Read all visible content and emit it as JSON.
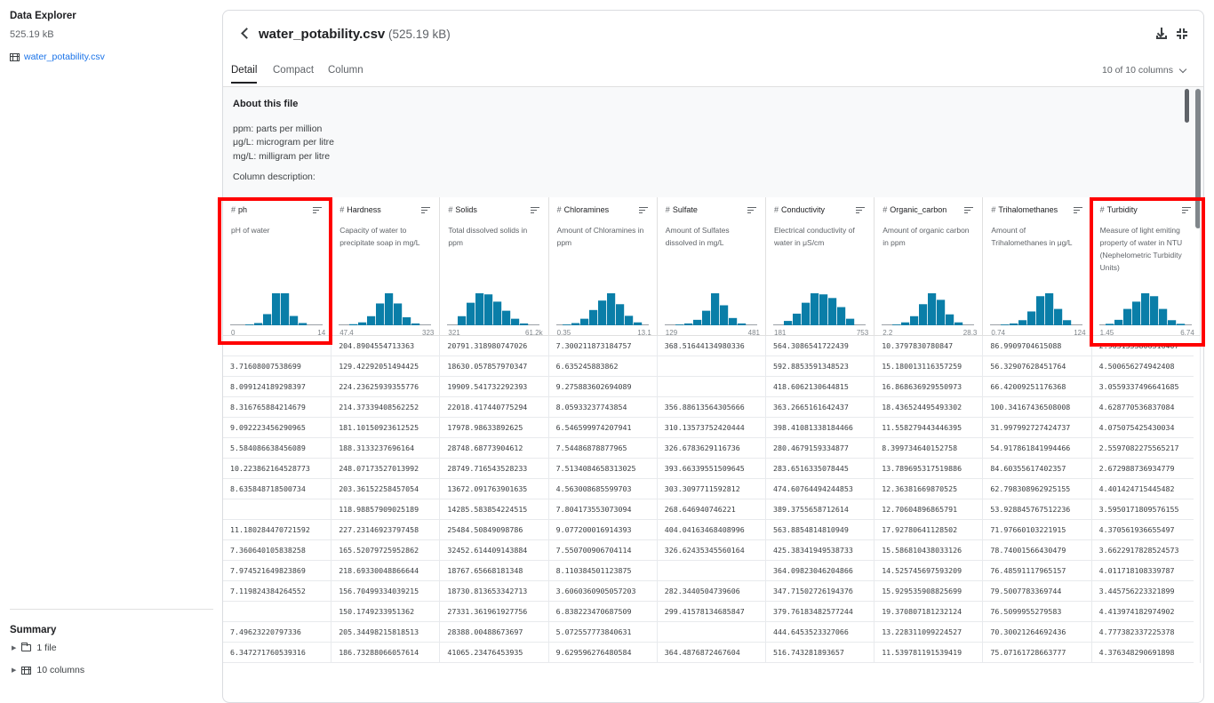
{
  "sidebar": {
    "title": "Data Explorer",
    "size": "525.19 kB",
    "file_name": "water_potability.csv",
    "summary_title": "Summary",
    "summary_items": [
      "1 file",
      "10 columns"
    ]
  },
  "header": {
    "file_name": "water_potability.csv",
    "file_size": "(525.19 kB)",
    "icons": [
      "back-icon",
      "download-icon",
      "collapse-icon"
    ]
  },
  "tabs": [
    "Detail",
    "Compact",
    "Column"
  ],
  "active_tab": "Detail",
  "column_count": "10 of 10 columns",
  "about": {
    "title": "About this file",
    "lines": [
      "ppm: parts per million",
      "μg/L: microgram per litre",
      "mg/L: milligram per litre",
      "Column description:"
    ]
  },
  "columns": [
    {
      "name": "ph",
      "desc": "pH of water",
      "min": "0",
      "max": "14",
      "hist": [
        2,
        6,
        30,
        86,
        86,
        25,
        6
      ]
    },
    {
      "name": "Hardness",
      "desc": "Capacity of water to precipitate soap in mg/L",
      "min": "47.4",
      "max": "323",
      "hist": [
        3,
        8,
        25,
        60,
        88,
        60,
        22,
        5
      ]
    },
    {
      "name": "Solids",
      "desc": "Total dissolved solids in ppm",
      "min": "321",
      "max": "61.2k",
      "hist": [
        25,
        62,
        88,
        85,
        65,
        40,
        18,
        5
      ]
    },
    {
      "name": "Chloramines",
      "desc": "Amount of Chloramines in ppm",
      "min": "0.35",
      "max": "13.1",
      "hist": [
        2,
        6,
        18,
        42,
        68,
        88,
        58,
        26,
        8
      ]
    },
    {
      "name": "Sulfate",
      "desc": "Amount of Sulfates dissolved in mg/L",
      "min": "129",
      "max": "481",
      "hist": [
        2,
        5,
        15,
        40,
        88,
        55,
        20,
        5
      ]
    },
    {
      "name": "Conductivity",
      "desc": "Electrical conductivity of water in μS/cm",
      "min": "181",
      "max": "753",
      "hist": [
        12,
        32,
        62,
        88,
        85,
        75,
        50,
        18
      ]
    },
    {
      "name": "Organic_carbon",
      "desc": "Amount of organic carbon in ppm",
      "min": "2.2",
      "max": "28.3",
      "hist": [
        2,
        8,
        25,
        58,
        88,
        70,
        30,
        8
      ]
    },
    {
      "name": "Trihalomethanes",
      "desc": "Amount of Trihalomethanes in μg/L",
      "min": "0.74",
      "max": "124",
      "hist": [
        2,
        5,
        14,
        38,
        80,
        88,
        45,
        14
      ]
    },
    {
      "name": "Turbidity",
      "desc": "Measure of light emiting property of water in NTU (Nephelometric Turbidity Units)",
      "min": "1.45",
      "max": "6.74",
      "hist": [
        4,
        15,
        45,
        65,
        88,
        80,
        45,
        14,
        4
      ]
    }
  ],
  "rows": [
    [
      "",
      "204.8904554713363",
      "20791.318980747026",
      "7.300211873184757",
      "368.51644134980336",
      "564.3086541722439",
      "10.3797830780847",
      "86.9909704615088",
      "2.9631353806316407"
    ],
    [
      "3.71608007538699",
      "129.42292051494425",
      "18630.057857970347",
      "6.635245883862",
      "",
      "592.8853591348523",
      "15.180013116357259",
      "56.32907628451764",
      "4.500656274942408"
    ],
    [
      "8.099124189298397",
      "224.23625939355776",
      "19909.541732292393",
      "9.275883602694089",
      "",
      "418.6062130644815",
      "16.868636929550973",
      "66.42009251176368",
      "3.0559337496641685"
    ],
    [
      "8.316765884214679",
      "214.37339408562252",
      "22018.417440775294",
      "8.05933237743854",
      "356.88613564305666",
      "363.2665161642437",
      "18.436524495493302",
      "100.34167436508008",
      "4.628770536837084"
    ],
    [
      "9.092223456290965",
      "181.10150923612525",
      "17978.98633892625",
      "6.546599974207941",
      "310.13573752420444",
      "398.41081338184466",
      "11.558279443446395",
      "31.997992727424737",
      "4.075075425430034"
    ],
    [
      "5.584086638456089",
      "188.3133237696164",
      "28748.68773904612",
      "7.54486878877965",
      "326.6783629116736",
      "280.4679159334877",
      "8.399734640152758",
      "54.917861841994466",
      "2.5597082275565217"
    ],
    [
      "10.223862164528773",
      "248.07173527013992",
      "28749.716543528233",
      "7.5134084658313025",
      "393.66339551509645",
      "283.6516335078445",
      "13.789695317519886",
      "84.60355617402357",
      "2.672988736934779"
    ],
    [
      "8.635848718500734",
      "203.36152258457054",
      "13672.091763901635",
      "4.563008685599703",
      "303.3097711592812",
      "474.60764494244853",
      "12.36381669870525",
      "62.798308962925155",
      "4.401424715445482"
    ],
    [
      "",
      "118.98857909025189",
      "14285.583854224515",
      "7.804173553073094",
      "268.646940746221",
      "389.3755658712614",
      "12.70604896865791",
      "53.928845767512236",
      "3.5950171809576155"
    ],
    [
      "11.180284470721592",
      "227.23146923797458",
      "25484.50849098786",
      "9.077200016914393",
      "404.04163468408996",
      "563.8854814810949",
      "17.92780641128502",
      "71.97660103221915",
      "4.370561936655497"
    ],
    [
      "7.360640105838258",
      "165.52079725952862",
      "32452.614409143884",
      "7.550700906704114",
      "326.62435345560164",
      "425.38341949538733",
      "15.586810438033126",
      "78.74001566430479",
      "3.6622917828524573"
    ],
    [
      "7.974521649823869",
      "218.69330048866644",
      "18767.65668181348",
      "8.110384501123875",
      "",
      "364.09823046204866",
      "14.525745697593209",
      "76.48591117965157",
      "4.011718108339787"
    ],
    [
      "7.119824384264552",
      "156.70499334039215",
      "18730.813653342713",
      "3.6060360905057203",
      "282.3440504739606",
      "347.7150272619437б",
      "15.929535908825699",
      "79.5007783369744",
      "3.445756223321899"
    ],
    [
      "",
      "150.1749233951362",
      "27331.361961927756",
      "6.838223470687509",
      "299.41578134685847",
      "379.76183482577244",
      "19.370807181232124",
      "76.5099955279583",
      "4.413974182974902"
    ],
    [
      "7.49623220797336",
      "205.34498215818513",
      "28388.00488673697",
      "5.072557773840631",
      "",
      "444.6453523327066",
      "13.228311099224527",
      "70.30021264692436",
      "4.777382337225378"
    ],
    [
      "6.347271760539316",
      "186.73288066057614",
      "41065.23476453935",
      "9.629596276480584",
      "364.4876872467604",
      "516.743281893657",
      "11.539781191539419",
      "75.07161728663777",
      "4.376348290691898"
    ]
  ],
  "colors": {
    "hist_bar": "#0a7ea8",
    "highlight": "#ff0000",
    "link": "#1a73e8"
  }
}
